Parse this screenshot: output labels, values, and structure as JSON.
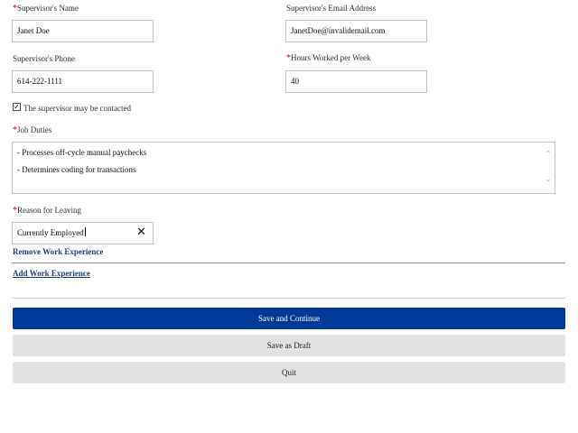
{
  "form": {
    "supervisor_name": {
      "label": "Supervisor's Name",
      "required": "*",
      "value": "Janet Doe"
    },
    "supervisor_email": {
      "label": "Supervisor's Email Address",
      "value": "JanetDoe@invalidemail.com"
    },
    "supervisor_phone": {
      "label": "Supervisor's Phone",
      "value": "614-222-1111"
    },
    "hours_per_week": {
      "label": "Hours Worked per Week",
      "required": "*",
      "value": "40"
    },
    "may_contact": {
      "label": "The supervisor may be contacted",
      "checked": true,
      "check_glyph": "✓"
    },
    "job_duties": {
      "label": "Job Duties",
      "required": "*",
      "lines": [
        "- Processes off-cycle manual paychecks",
        "- Determines coding for transactions"
      ]
    },
    "reason_for_leaving": {
      "label": "Reason for Leaving",
      "required": "*",
      "value": "Currently Employed",
      "clear_glyph": "✕"
    }
  },
  "links": {
    "remove_work_experience": "Remove Work Experience",
    "add_work_experience": "Add Work Experience"
  },
  "buttons": {
    "save_continue": "Save and Continue",
    "save_draft": "Save as Draft",
    "quit": "Quit"
  },
  "scroll_arrows": {
    "up": "⌃",
    "down": "⌄"
  },
  "colors": {
    "primary": "#003a99",
    "link": "#1f3f7a",
    "required": "#d40000",
    "secondary_button": "#e2e2e2"
  }
}
